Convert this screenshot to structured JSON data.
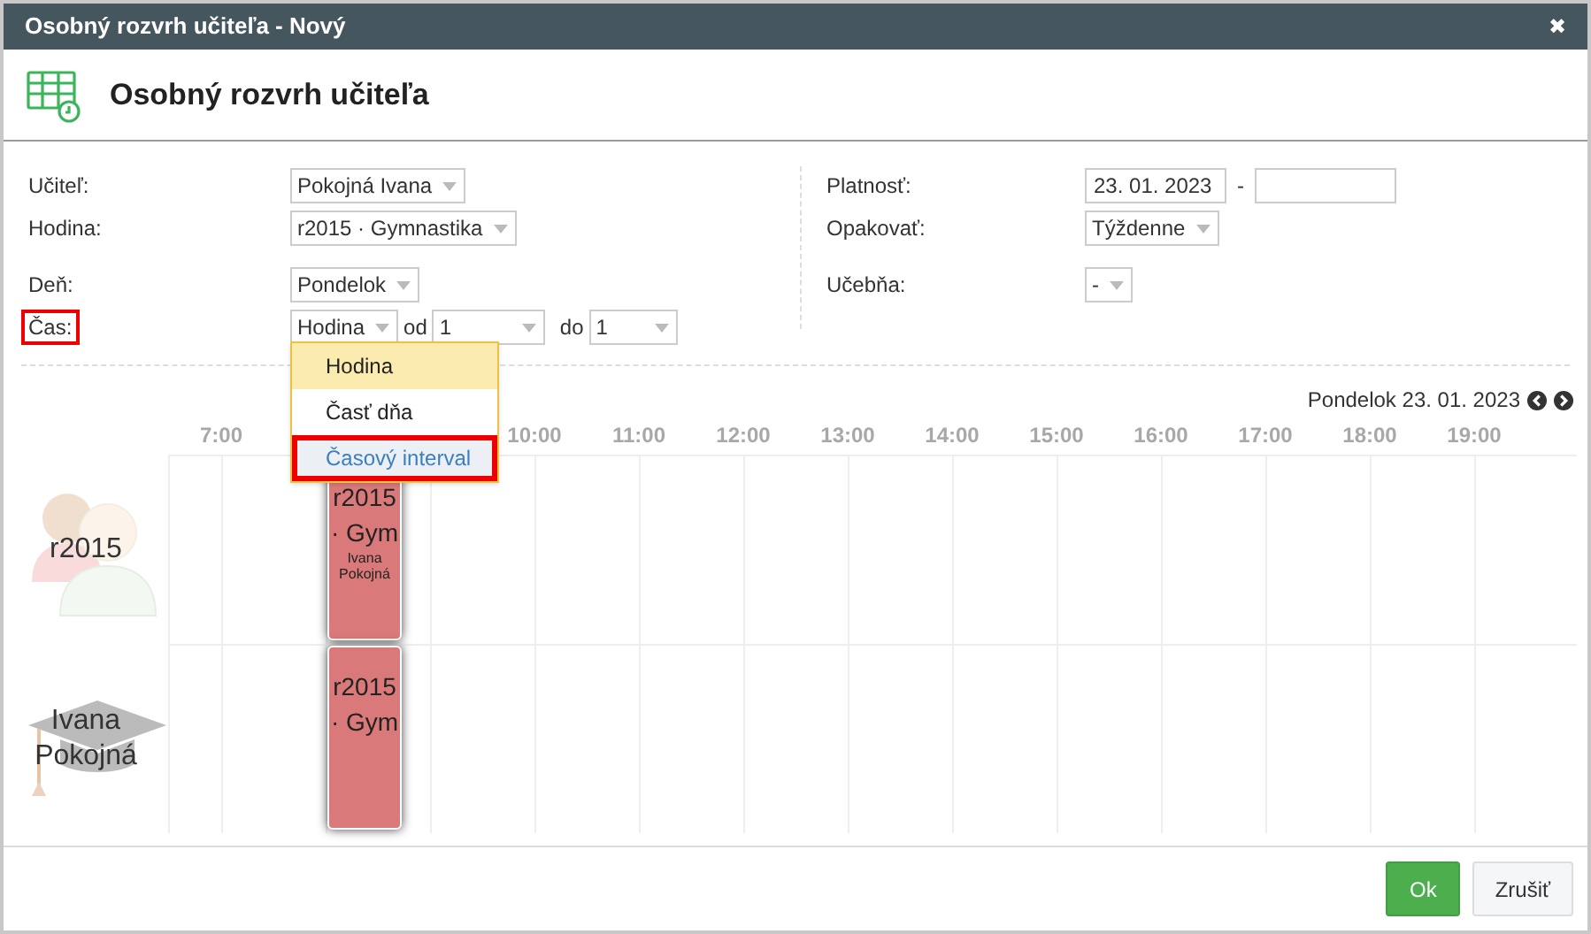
{
  "window": {
    "title": "Osobný rozvrh učiteľa - Nový",
    "close": "✖"
  },
  "header": {
    "title": "Osobný rozvrh učiteľa"
  },
  "form": {
    "left": [
      [
        {
          "label": "Učiteľ:",
          "kind": "select",
          "value": "Pokojná Ivana",
          "highlighted": false
        },
        {
          "label": "Hodina:",
          "kind": "select",
          "value": "r2015 · Gymnastika",
          "highlighted": false
        }
      ],
      [
        {
          "label": "Deň:",
          "kind": "select",
          "value": "Pondelok",
          "highlighted": false
        },
        {
          "label": "Čas:",
          "kind": "time",
          "value": "Hodina",
          "from_label": "od",
          "from_value": "1",
          "to_label": "do",
          "to_value": "1",
          "highlighted": true
        }
      ]
    ],
    "right": [
      [
        {
          "label": "Platnosť:",
          "kind": "daterange",
          "value": "23. 01. 2023",
          "separator": "-"
        },
        {
          "label": "Opakovať:",
          "kind": "select",
          "value": "Týždenne"
        }
      ],
      [
        {
          "label": "Učebňa:",
          "kind": "select",
          "value": "-"
        }
      ]
    ]
  },
  "dropdown_menu": [
    {
      "label": "Hodina",
      "selected": true,
      "highlighted": false
    },
    {
      "label": "Časť dňa",
      "selected": false,
      "highlighted": false
    },
    {
      "label": "Časový interval",
      "selected": false,
      "highlighted": true
    }
  ],
  "timeline": {
    "date": "Pondelok 23. 01. 2023",
    "hours": [
      "7:00",
      "10:00",
      "11:00",
      "12:00",
      "13:00",
      "14:00",
      "15:00",
      "16:00",
      "17:00",
      "18:00",
      "19:00"
    ],
    "rows": [
      {
        "label": "r2015",
        "kind": "group",
        "events": [
          {
            "title": "r2015 · Gym",
            "subtitle": "Ivana Pokojná"
          }
        ]
      },
      {
        "label": "Ivana Pokojná",
        "kind": "teacher",
        "events": [
          {
            "title": "r2015 · Gym"
          }
        ]
      }
    ]
  },
  "buttons": [
    {
      "label": "Ok",
      "kind": "primary"
    },
    {
      "label": "Zrušiť",
      "kind": "secondary"
    }
  ]
}
